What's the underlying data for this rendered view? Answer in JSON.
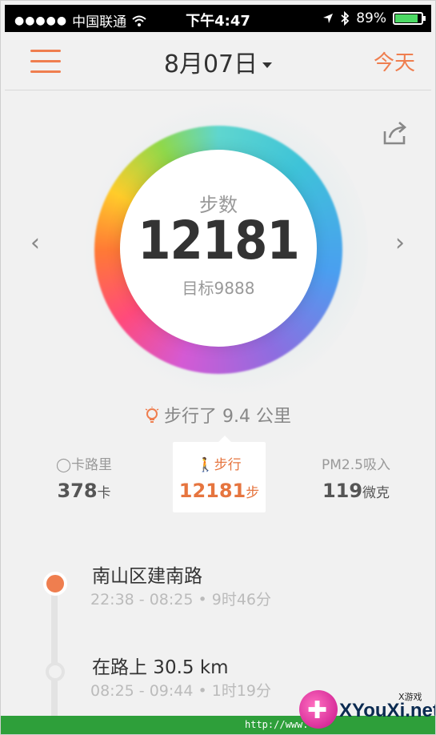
{
  "status_bar": {
    "carrier": "中国联通",
    "signal": "●●●●●",
    "time": "下午4:47",
    "battery": "89%",
    "battery_level": 0.89
  },
  "nav": {
    "date": "8月07日",
    "today": "今天",
    "icons": [
      "menu-icon",
      "chevron-down-icon"
    ]
  },
  "ring": {
    "label": "步数",
    "value": "12181",
    "goal": "目标9888"
  },
  "distance_text": "步行了 9.4 公里",
  "stats": {
    "calories": {
      "label": "卡路里",
      "value": "378",
      "unit": "卡"
    },
    "steps": {
      "label": "步行",
      "value": "12181",
      "unit": "步"
    },
    "pm25": {
      "label": "PM2.5吸入",
      "value": "119",
      "unit": "微克"
    }
  },
  "timeline": [
    {
      "title": "南山区建南路",
      "sub": "22:38 - 08:25 • 9时46分"
    },
    {
      "title": "在路上 30.5 km",
      "sub": "08:25 - 09:44 • 1时19分"
    }
  ],
  "watermark": {
    "url": "http://www.",
    "brand": "XYouXi.net",
    "small": "X游戏"
  },
  "colors": {
    "accent": "#ef7e4f"
  }
}
